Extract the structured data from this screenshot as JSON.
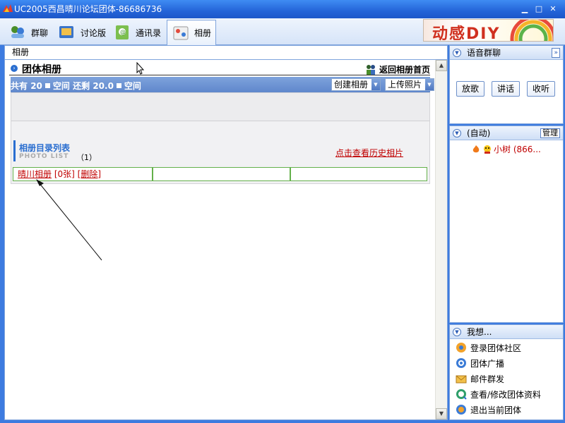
{
  "window": {
    "title": "UC2005西昌晴川论坛团体-86686736"
  },
  "tabs": [
    {
      "label": "群聊",
      "icon": "group-chat-icon"
    },
    {
      "label": "讨论版",
      "icon": "board-icon"
    },
    {
      "label": "通讯录",
      "icon": "contacts-icon"
    },
    {
      "label": "相册",
      "icon": "album-icon",
      "active": true
    }
  ],
  "banner": {
    "text": "动感DIY"
  },
  "left": {
    "header": "相册",
    "group_title": "团体相册",
    "back_link": "返回相册首页",
    "stats": {
      "prefix": "共有",
      "total": "20",
      "space1": "空间",
      "remain_label": "还剩",
      "remain": "20.0",
      "space2": "空间"
    },
    "create_button": "创建相册",
    "upload_button": "上传照片",
    "dir_title": "相册目录列表",
    "dir_subtitle": "PHOTO LIST",
    "dir_count": "（1）",
    "history_link": "点击查看历史相片",
    "album": {
      "name": "晴川相册",
      "count": "[0张]",
      "delete": "[删除]"
    }
  },
  "right": {
    "voice": {
      "title": "语音群聊",
      "buttons": [
        "放歌",
        "讲话",
        "收听"
      ]
    },
    "members": {
      "title": "(自动)",
      "manage": "管理",
      "member": "小树 (866..."
    },
    "want": {
      "title": "我想...",
      "items": [
        {
          "label": "登录团体社区",
          "icon": "community-icon"
        },
        {
          "label": "团体广播",
          "icon": "broadcast-icon"
        },
        {
          "label": "邮件群发",
          "icon": "mail-icon"
        },
        {
          "label": "查看/修改团体资料",
          "icon": "profile-icon"
        },
        {
          "label": "退出当前团体",
          "icon": "exit-icon"
        }
      ]
    }
  },
  "colors": {
    "titlebar": "#2464d8",
    "accent_blue": "#2a6ed0",
    "link_red": "#c00000",
    "cell_border": "#63b04a"
  }
}
